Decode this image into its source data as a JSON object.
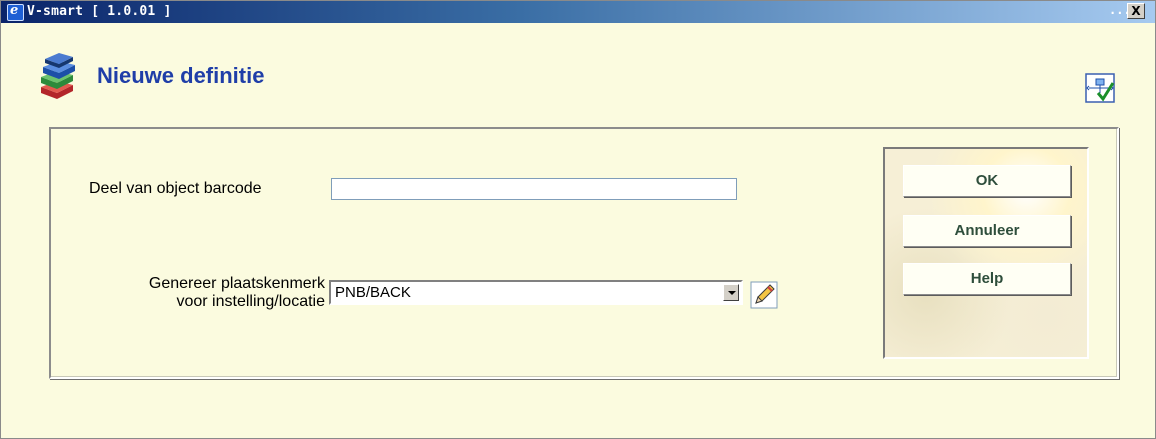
{
  "window": {
    "title": "V-smart [ 1.0.01 ]",
    "title_ellipsis": "...",
    "close_label": "X"
  },
  "header": {
    "title": "Nieuwe definitie",
    "left_icon": "books-icon",
    "right_icon": "tree-structure-check-icon"
  },
  "form": {
    "barcode": {
      "label": "Deel van object barcode",
      "value": ""
    },
    "location": {
      "label_line1": "Genereer plaatskenmerk",
      "label_line2": "voor instelling/locatie",
      "selected": "PNB/BACK",
      "edit_icon": "pencil-icon"
    }
  },
  "buttons": {
    "ok": "OK",
    "cancel": "Annuleer",
    "help": "Help"
  },
  "colors": {
    "background": "#fbfbdf",
    "title_text": "#1f3ea8",
    "button_text": "#2e4e3b",
    "titlebar_start": "#0a246a"
  }
}
